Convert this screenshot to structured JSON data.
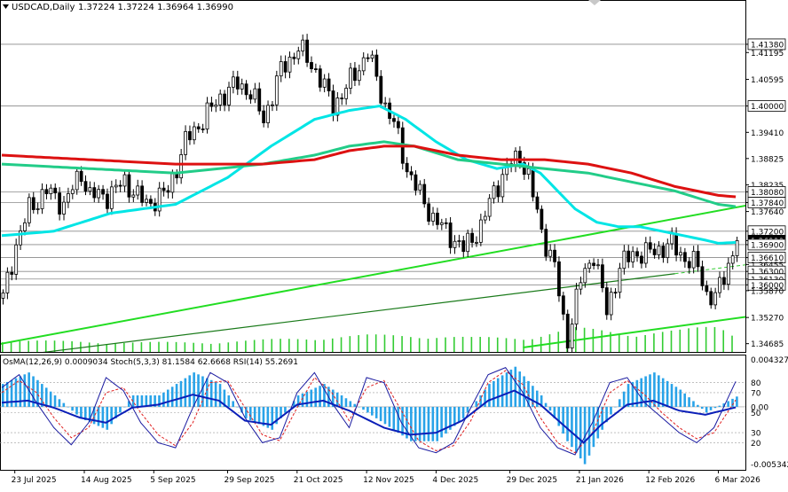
{
  "chart_data": {
    "type": "line",
    "header": {
      "symbol": "USDCAD,Daily",
      "ohlc": "1.37224 1.37224 1.36964 1.36990"
    },
    "price_axis": {
      "ylim": [
        1.345,
        1.4235
      ],
      "ticks": [
        "1.41380",
        "1.41195",
        "1.40595",
        "1.40000",
        "1.39410",
        "1.38825",
        "1.38235",
        "1.38080",
        "1.37840",
        "1.37640",
        "1.37200",
        "1.36990",
        "1.36900",
        "1.36610",
        "1.36455",
        "1.36300",
        "1.36130",
        "1.36000",
        "1.35870",
        "1.35270",
        "1.34685"
      ],
      "ticks_values": [
        1.4138,
        1.41195,
        1.40595,
        1.4,
        1.3941,
        1.38825,
        1.38235,
        1.3808,
        1.3784,
        1.3764,
        1.372,
        1.3699,
        1.369,
        1.3661,
        1.36455,
        1.363,
        1.3613,
        1.36,
        1.3587,
        1.3527,
        1.34685
      ],
      "boxed_ticks": [
        "1.41380",
        "1.40000",
        "1.38080",
        "1.37840",
        "1.37200",
        "1.36990",
        "1.36900",
        "1.36610",
        "1.36300",
        "1.36130",
        "1.36000"
      ],
      "current": "1.36990"
    },
    "levels": [
      1.4138,
      1.4,
      1.3808,
      1.3784,
      1.372,
      1.369,
      1.3661,
      1.363,
      1.3613,
      1.36
    ],
    "x_labels": [
      "23 Jul 2025",
      "14 Aug 2025",
      "5 Sep 2025",
      "29 Sep 2025",
      "21 Oct 2025",
      "12 Nov 2025",
      "4 Dec 2025",
      "29 Dec 2025",
      "21 Jan 2026",
      "12 Feb 2026",
      "6 Mar 2026"
    ],
    "x_label_index": [
      3,
      19,
      35,
      52,
      68,
      84,
      100,
      117,
      133,
      149,
      165
    ],
    "bars_count": 170,
    "candles": {
      "anchors_index": [
        0,
        3,
        6,
        10,
        14,
        18,
        20,
        24,
        28,
        33,
        38,
        42,
        46,
        50,
        54,
        57,
        60,
        64,
        68,
        72,
        76,
        79,
        84,
        88,
        90,
        93,
        96,
        99,
        102,
        106,
        110,
        113,
        116,
        119,
        121,
        124,
        127,
        129,
        130,
        133,
        136,
        139,
        142,
        145,
        148,
        151,
        154,
        157,
        160,
        162,
        164,
        166,
        169
      ],
      "anchors_close": [
        1.357,
        1.369,
        1.377,
        1.381,
        1.378,
        1.385,
        1.38,
        1.38,
        1.383,
        1.378,
        1.381,
        1.392,
        1.397,
        1.402,
        1.405,
        1.403,
        1.397,
        1.408,
        1.413,
        1.408,
        1.4,
        1.404,
        1.412,
        1.4,
        1.396,
        1.386,
        1.38,
        1.375,
        1.372,
        1.368,
        1.373,
        1.381,
        1.386,
        1.389,
        1.384,
        1.372,
        1.364,
        1.352,
        1.348,
        1.361,
        1.367,
        1.354,
        1.364,
        1.367,
        1.367,
        1.368,
        1.369,
        1.366,
        1.364,
        1.358,
        1.357,
        1.362,
        1.3699
      ]
    },
    "ma_series": [
      {
        "color": "#00e5e5",
        "index": [
          0,
          12,
          25,
          40,
          52,
          62,
          72,
          80,
          87,
          93,
          100,
          107,
          114,
          120,
          124,
          128,
          132,
          137,
          142,
          147,
          152,
          157,
          162,
          165,
          169
        ],
        "values": [
          1.371,
          1.372,
          1.376,
          1.378,
          1.384,
          1.391,
          1.397,
          1.399,
          1.4,
          1.397,
          1.392,
          1.388,
          1.386,
          1.387,
          1.385,
          1.381,
          1.377,
          1.374,
          1.373,
          1.373,
          1.372,
          1.371,
          1.37,
          1.3693,
          1.3695
        ]
      },
      {
        "color": "#22cc88",
        "index": [
          0,
          20,
          40,
          60,
          72,
          80,
          88,
          95,
          105,
          115,
          125,
          135,
          145,
          155,
          165,
          169
        ],
        "values": [
          1.387,
          1.386,
          1.385,
          1.387,
          1.389,
          1.391,
          1.392,
          1.391,
          1.388,
          1.387,
          1.386,
          1.385,
          1.383,
          1.381,
          1.378,
          1.3775
        ]
      },
      {
        "color": "#dd1111",
        "index": [
          0,
          20,
          40,
          60,
          72,
          80,
          88,
          95,
          105,
          115,
          125,
          135,
          145,
          155,
          165,
          169
        ],
        "values": [
          1.389,
          1.388,
          1.387,
          1.387,
          1.388,
          1.39,
          1.391,
          1.391,
          1.389,
          1.388,
          1.388,
          1.387,
          1.385,
          1.382,
          1.38,
          1.3797
        ]
      }
    ],
    "trendlines": [
      {
        "color": "#22dd22",
        "from_index": -2,
        "from": 1.3465,
        "to_index": 220,
        "to": 1.3865,
        "dashed": false
      },
      {
        "color": "#22dd22",
        "from_index": 120,
        "from": 1.346,
        "to_index": 225,
        "to": 1.36,
        "dashed": false
      },
      {
        "color": "#1a7a1a",
        "from_index": -2,
        "from": 1.3435,
        "to_index": 155,
        "to": 1.3625,
        "dashed": false
      },
      {
        "color": "#33cc33",
        "from_index": 155,
        "from": 1.3625,
        "to_index": 225,
        "to": 1.371,
        "dashed": true
      }
    ],
    "volume_index": [
      0,
      12,
      24,
      36,
      48,
      60,
      72,
      84,
      96,
      108,
      120,
      132,
      144,
      156,
      165,
      169
    ],
    "volume": [
      0.4,
      0.35,
      0.3,
      0.3,
      0.3,
      0.4,
      0.5,
      0.6,
      0.6,
      0.5,
      0.5,
      0.9,
      0.7,
      0.8,
      1.0,
      0.6
    ],
    "oscillator": {
      "legend": "OsMA(12,26,9) 0.0009034  Stoch(5,3,3) 81.1584 62.6668  RSI(14) 55.2691",
      "ylim_top": "0.004327",
      "ylim_bottom": "-0.005342",
      "osma_range": [
        -0.005342,
        0.004327
      ],
      "levels": [
        "80",
        "70",
        "50",
        "30",
        "20"
      ],
      "levels_values": [
        80,
        70,
        50,
        30,
        20
      ],
      "zero_label": "0.00",
      "osma_index": [
        0,
        6,
        12,
        18,
        24,
        30,
        36,
        44,
        50,
        56,
        62,
        68,
        74,
        80,
        88,
        94,
        100,
        106,
        112,
        118,
        124,
        130,
        134,
        138,
        144,
        150,
        156,
        162,
        169
      ],
      "osma": [
        0.002,
        0.003,
        0.001,
        -0.001,
        -0.002,
        0.001,
        0.001,
        0.003,
        0.002,
        -0.001,
        -0.002,
        0.001,
        0.002,
        0.0005,
        -0.0015,
        -0.003,
        -0.003,
        -0.001,
        0.002,
        0.0035,
        0.001,
        -0.003,
        -0.005,
        -0.002,
        0.002,
        0.003,
        0.0015,
        -0.0005,
        0.0009
      ],
      "rsi_index": [
        0,
        6,
        12,
        18,
        24,
        30,
        36,
        44,
        50,
        56,
        62,
        68,
        74,
        80,
        88,
        94,
        100,
        106,
        112,
        118,
        124,
        130,
        134,
        138,
        144,
        150,
        156,
        162,
        169
      ],
      "rsi": [
        60,
        62,
        55,
        45,
        40,
        55,
        58,
        68,
        62,
        42,
        38,
        58,
        62,
        52,
        35,
        28,
        30,
        42,
        62,
        72,
        58,
        35,
        20,
        38,
        58,
        62,
        52,
        48,
        55.27
      ],
      "stoch_k_index": [
        0,
        4,
        8,
        12,
        16,
        20,
        24,
        28,
        32,
        36,
        40,
        44,
        48,
        52,
        56,
        60,
        64,
        68,
        72,
        76,
        80,
        84,
        88,
        92,
        96,
        100,
        104,
        108,
        112,
        116,
        120,
        124,
        128,
        132,
        136,
        140,
        144,
        148,
        152,
        156,
        160,
        164,
        169
      ],
      "stoch_k": [
        75,
        88,
        60,
        35,
        18,
        40,
        85,
        72,
        40,
        20,
        15,
        55,
        90,
        80,
        45,
        20,
        25,
        70,
        90,
        60,
        35,
        85,
        80,
        40,
        15,
        10,
        20,
        55,
        88,
        95,
        70,
        35,
        15,
        8,
        40,
        80,
        85,
        60,
        45,
        30,
        20,
        35,
        81.16
      ],
      "stoch_d_index": [
        0,
        4,
        8,
        12,
        16,
        20,
        24,
        28,
        32,
        36,
        40,
        44,
        48,
        52,
        56,
        60,
        64,
        68,
        72,
        76,
        80,
        84,
        88,
        92,
        96,
        100,
        104,
        108,
        112,
        116,
        120,
        124,
        128,
        132,
        136,
        140,
        144,
        148,
        152,
        156,
        160,
        164,
        169
      ],
      "stoch_d": [
        70,
        82,
        70,
        45,
        25,
        35,
        70,
        75,
        50,
        28,
        17,
        40,
        80,
        82,
        55,
        28,
        22,
        55,
        85,
        70,
        42,
        75,
        82,
        52,
        22,
        12,
        17,
        42,
        80,
        92,
        78,
        45,
        20,
        10,
        30,
        70,
        82,
        68,
        50,
        35,
        24,
        30,
        62.67
      ]
    }
  }
}
